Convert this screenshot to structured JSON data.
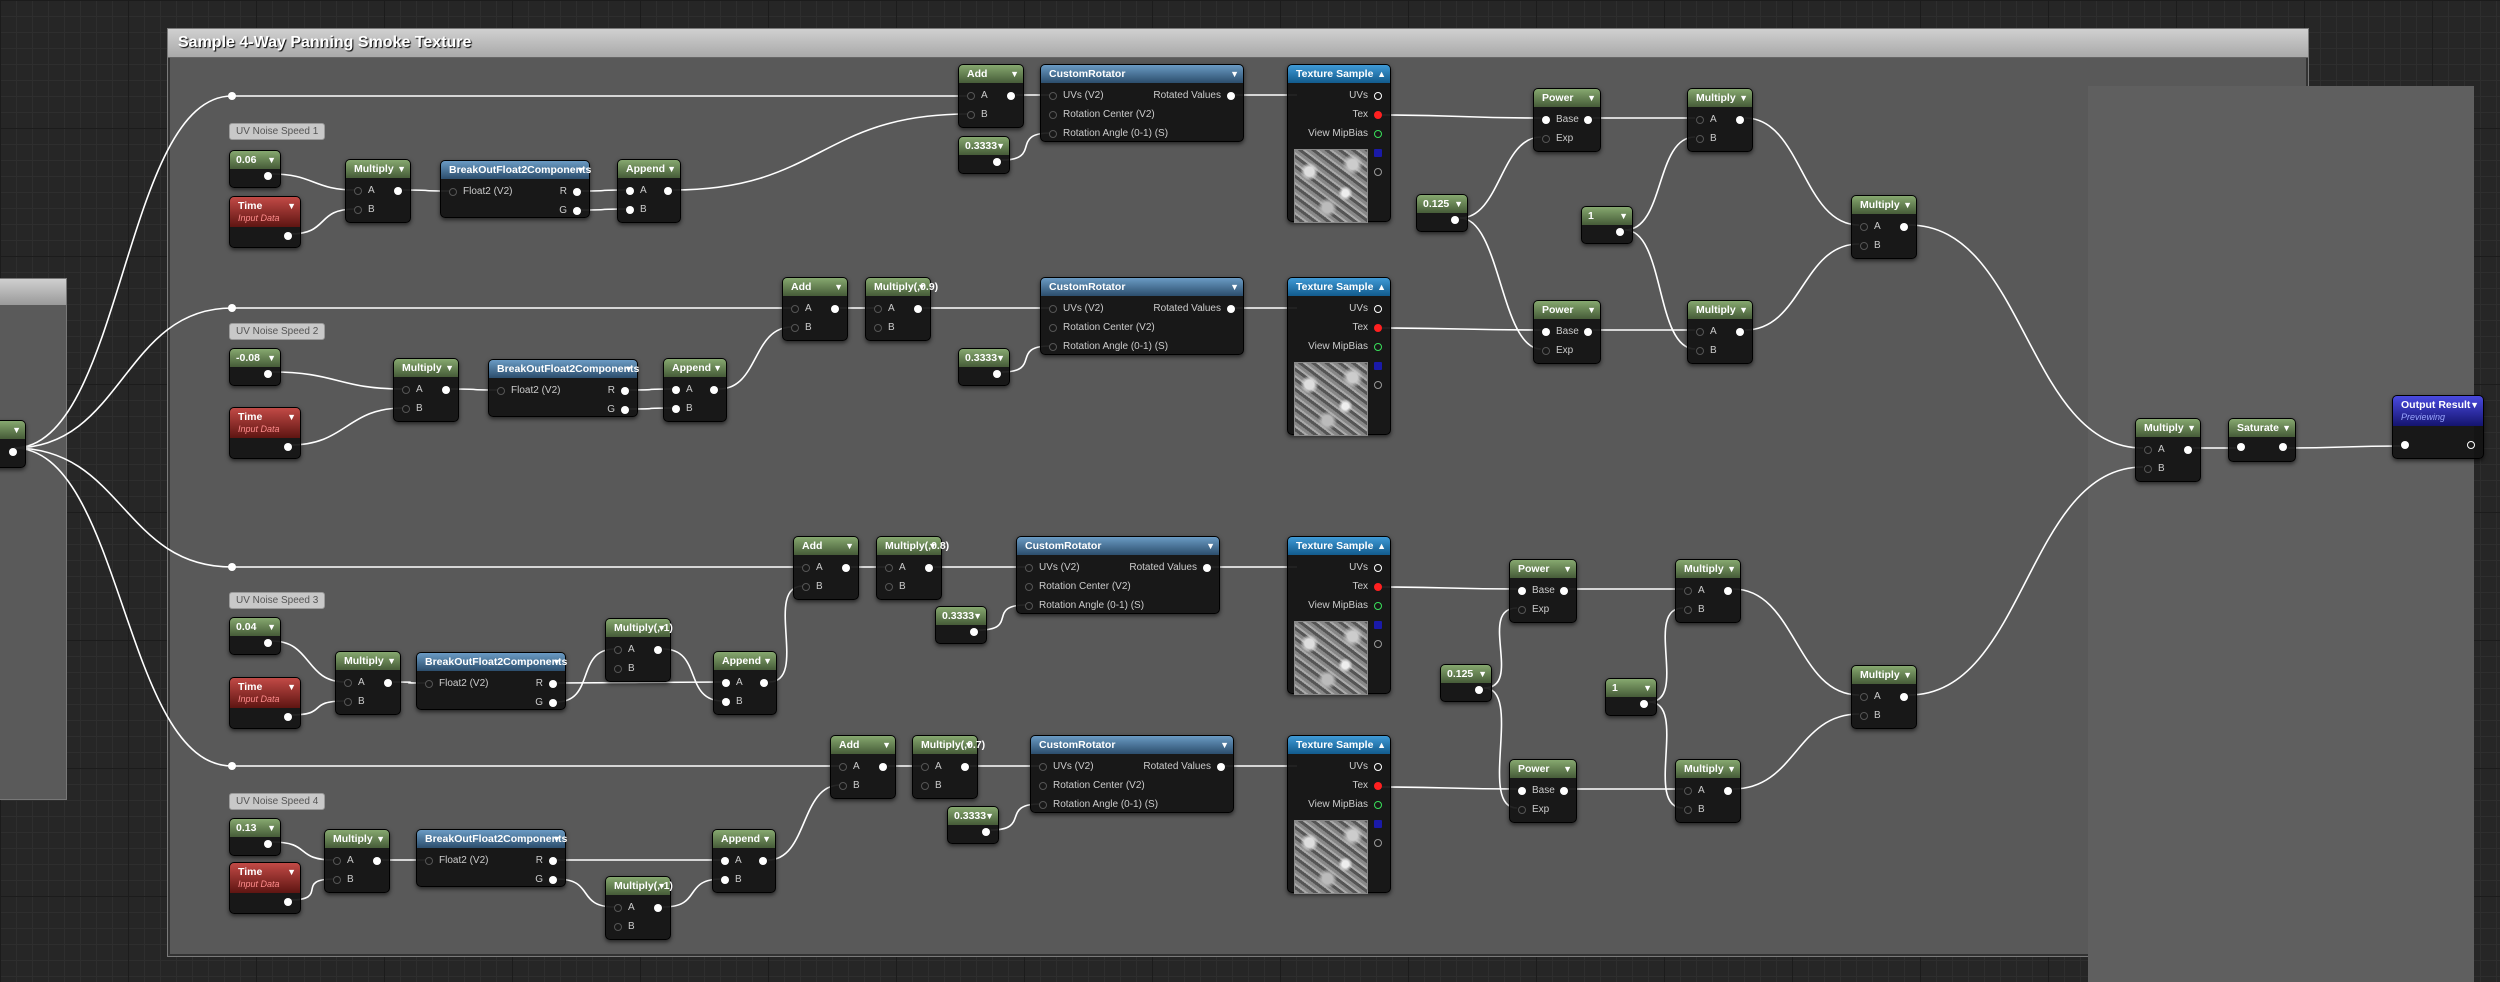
{
  "comment_title": "Sample 4-Way Panning Smoke Texture",
  "labels": {
    "speed1": "UV Noise Speed 1",
    "speed2": "UV Noise Speed 2",
    "speed3": "UV Noise Speed 3",
    "speed4": "UV Noise Speed 4"
  },
  "constants": {
    "s1": "0.06",
    "s2": "-0.08",
    "s3": "0.04",
    "s4": "0.13",
    "r1": "0.3333",
    "r2": "0.3333",
    "r3": "0.3333",
    "r4": "0.3333",
    "e1": "0.125",
    "e2": "0.125",
    "one1": "1",
    "one2": "1"
  },
  "node_titles": {
    "add": "Add",
    "multiply": "Multiply",
    "break": "BreakOutFloat2Components",
    "append": "Append",
    "time": "Time",
    "time_sub": "Input Data",
    "rotator": "CustomRotator",
    "texture": "Texture Sample",
    "power": "Power",
    "saturate": "Saturate",
    "output": "Output Result",
    "output_sub": "Previewing",
    "mul09": "Multiply(,0.9)",
    "mul08": "Multiply(,0.8)",
    "mul07": "Multiply(,0.7)",
    "mulneg": "Multiply(,-1)"
  },
  "pins": {
    "a": "A",
    "b": "B",
    "float2": "Float2 (V2)",
    "r": "R",
    "g": "G",
    "uvs_v2": "UVs (V2)",
    "rot_center": "Rotation Center (V2)",
    "rot_angle": "Rotation Angle (0-1) (S)",
    "rotated": "Rotated Values",
    "uvs": "UVs",
    "tex": "Tex",
    "mip": "View MipBias",
    "base": "Base",
    "exp": "Exp"
  },
  "colors": {
    "material_node": "#5e7a4a",
    "function_node": "#3d6a8f",
    "texture_node": "#1b74b3",
    "input_node": "#8c2420",
    "output_node": "#22229a",
    "wire": "#ffffff",
    "tex_pin": "#ff2020"
  },
  "icons": {
    "collapse": "triangle-down-icon",
    "expand": "triangle-up-icon",
    "output_pin": "exec-pin-icon"
  }
}
